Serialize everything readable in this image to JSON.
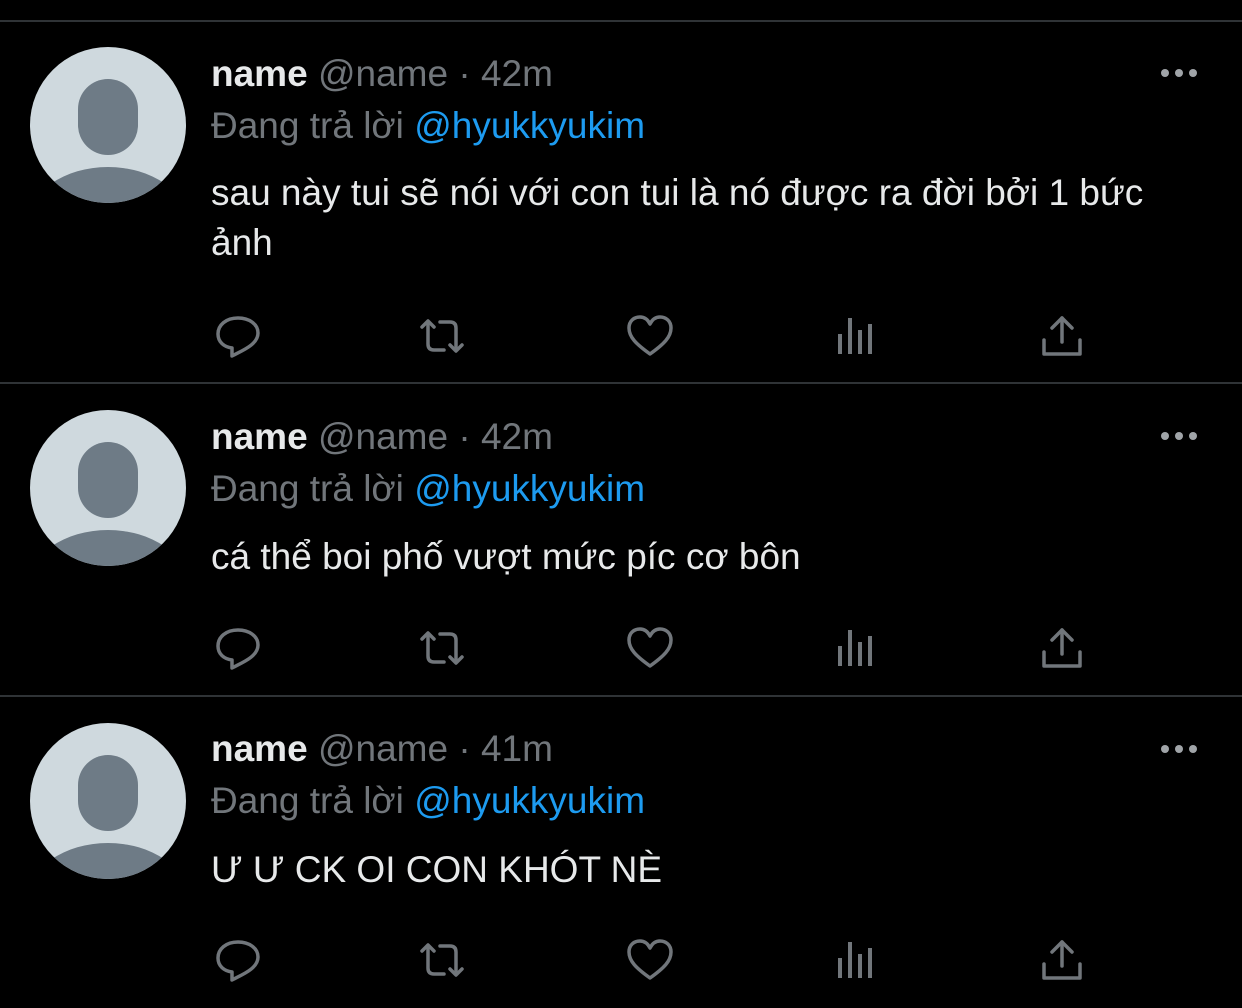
{
  "tweets": [
    {
      "name": "name",
      "handle": "@name",
      "separator": "·",
      "time": "42m",
      "reply_prefix": "Đang trả lời",
      "reply_to": "@hyukkyukim",
      "text": "sau này tui sẽ nói với con tui là nó được ra đời bởi 1 bức ảnh"
    },
    {
      "name": "name",
      "handle": "@name",
      "separator": "·",
      "time": "42m",
      "reply_prefix": "Đang trả lời",
      "reply_to": "@hyukkyukim",
      "text": "cá thể boi phố vượt mức píc cơ bôn"
    },
    {
      "name": "name",
      "handle": "@name",
      "separator": "·",
      "time": "41m",
      "reply_prefix": "Đang trả lời",
      "reply_to": "@hyukkyukim",
      "text": "Ư Ư CK OI CON KHÓT NÈ"
    }
  ],
  "icons": {
    "more": "more-options-icon",
    "reply": "reply-icon",
    "retweet": "retweet-icon",
    "like": "like-icon",
    "views": "views-icon",
    "share": "share-icon"
  },
  "colors": {
    "background": "#000000",
    "text": "#e7e9ea",
    "muted": "#71767b",
    "mention": "#1d9bf0",
    "divider": "#2f3336",
    "avatar_bg": "#cfd9de",
    "avatar_fg": "#6e7b86"
  }
}
